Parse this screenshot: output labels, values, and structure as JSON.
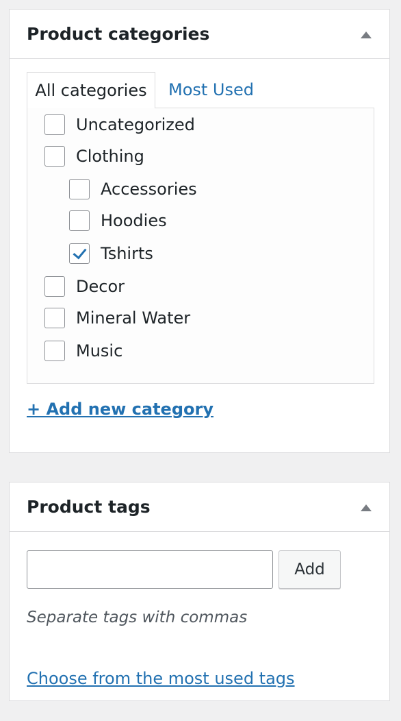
{
  "categories_box": {
    "title": "Product categories",
    "tabs": [
      {
        "label": "All categories"
      },
      {
        "label": "Most Used"
      }
    ],
    "items": [
      {
        "label": "Uncategorized",
        "checked": false,
        "level": 0
      },
      {
        "label": "Clothing",
        "checked": false,
        "level": 0
      },
      {
        "label": "Accessories",
        "checked": false,
        "level": 1
      },
      {
        "label": "Hoodies",
        "checked": false,
        "level": 1
      },
      {
        "label": "Tshirts",
        "checked": true,
        "level": 1
      },
      {
        "label": "Decor",
        "checked": false,
        "level": 0
      },
      {
        "label": "Mineral Water",
        "checked": false,
        "level": 0
      },
      {
        "label": "Music",
        "checked": false,
        "level": 0
      }
    ],
    "add_new_label": "+ Add new category"
  },
  "tags_box": {
    "title": "Product tags",
    "input_value": "",
    "add_button_label": "Add",
    "hint": "Separate tags with commas",
    "most_used_link": "Choose from the most used tags"
  },
  "colors": {
    "link": "#2271b1",
    "background": "#f0f0f1"
  }
}
